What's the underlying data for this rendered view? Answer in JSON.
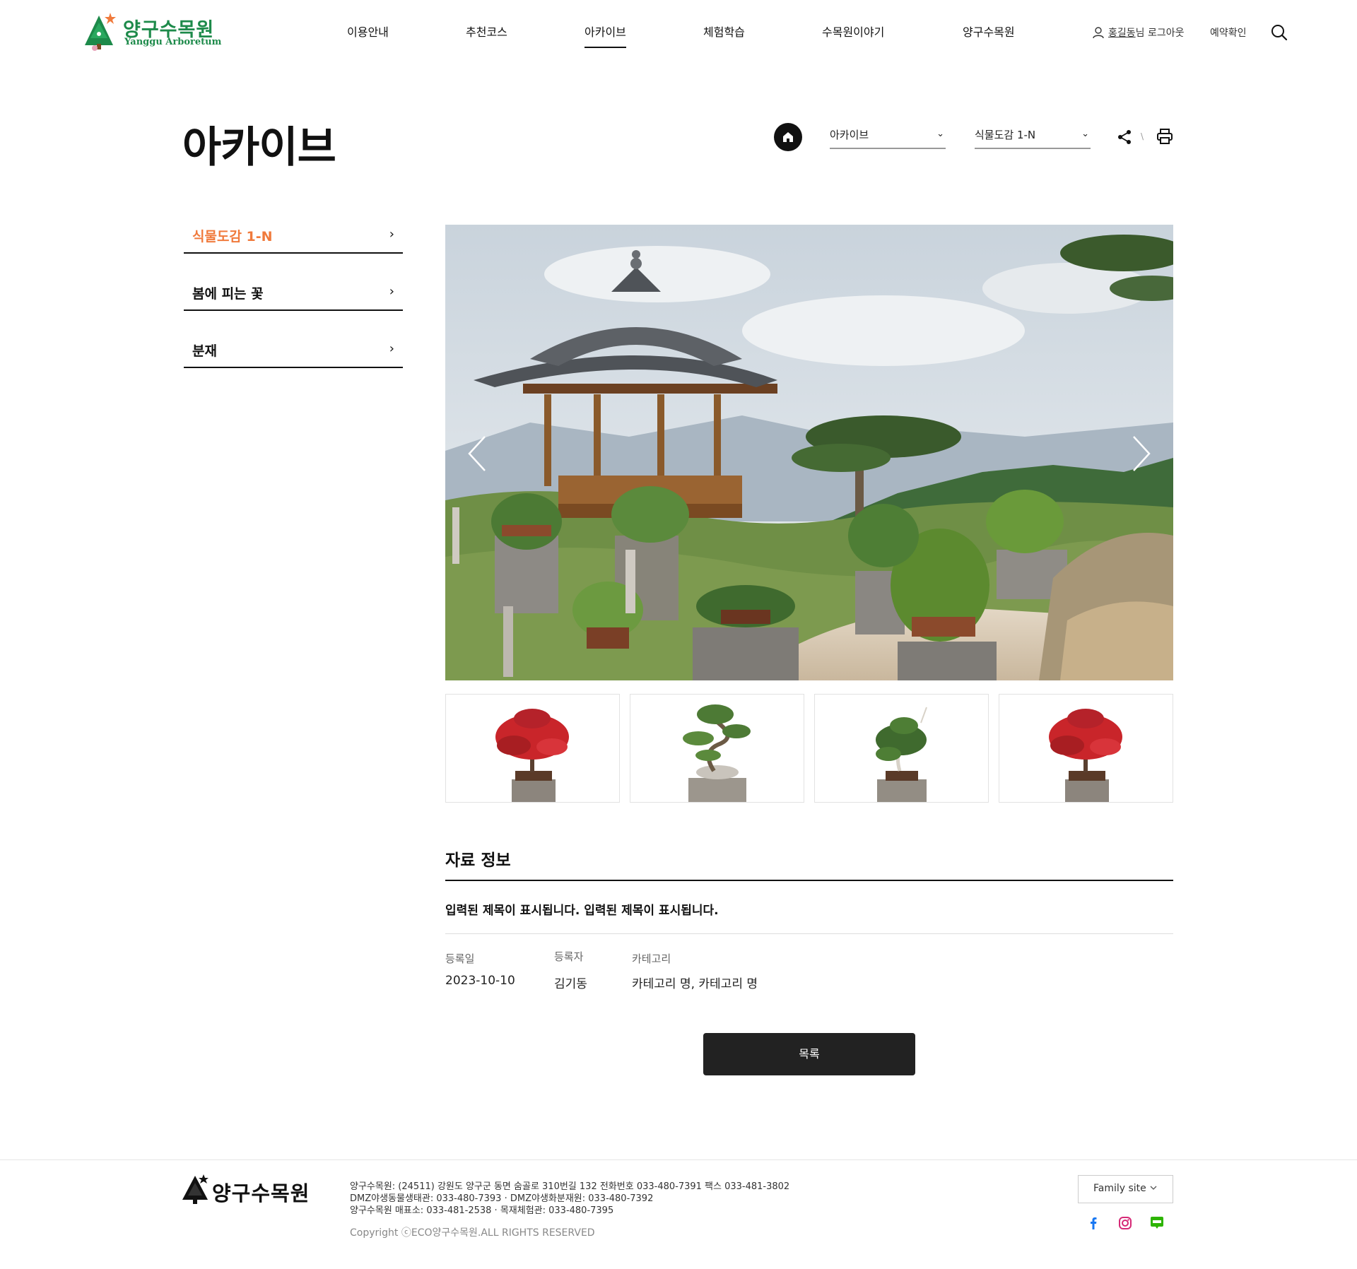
{
  "header": {
    "logo_ko": "양구수목원",
    "logo_en": "Yanggu Arboretum",
    "nav": [
      {
        "label": "이용안내",
        "active": false
      },
      {
        "label": "추천코스",
        "active": false
      },
      {
        "label": "아카이브",
        "active": true
      },
      {
        "label": "체험학습",
        "active": false
      },
      {
        "label": "수목원이야기",
        "active": false
      },
      {
        "label": "양구수목원",
        "active": false
      }
    ],
    "user_name": "홍길동",
    "user_suffix": "님 로그아웃",
    "reservation_check": "예약확인",
    "search_icon": "search-icon"
  },
  "page": {
    "title": "아카이브",
    "location": {
      "depth1": "아카이브",
      "depth2": "식물도감 1-N"
    }
  },
  "side_menu": [
    {
      "label": "식물도감 1-N",
      "active": true
    },
    {
      "label": "봄에 피는 꽃",
      "active": false
    },
    {
      "label": "분재",
      "active": false
    }
  ],
  "gallery": {
    "main_image": "pavilion-bonsai-garden-photo",
    "thumbnails": [
      "red-maple-bonsai",
      "pine-bonsai",
      "juniper-bonsai",
      "red-maple-bonsai"
    ]
  },
  "info": {
    "heading": "자료 정보",
    "title": "입력된 제목이 표시됩니다. 입력된 제목이 표시됩니다.",
    "meta": [
      {
        "label": "등록일",
        "value": "2023-10-10"
      },
      {
        "label": "등록자",
        "value": "김기동"
      },
      {
        "label": "카테고리",
        "value": "카테고리 명, 카테고리 명"
      }
    ],
    "list_button": "목록"
  },
  "footer": {
    "logo": "양구수목원",
    "address_lines": [
      "양구수목원: (24511) 강원도 양구군 동면 숨골로 310번길 132 전화번호 033-480-7391 팩스 033-481-3802",
      "DMZ야생동물생태관: 033-480-7393 · DMZ야생화분재원: 033-480-7392",
      "양구수목원 매표소: 033-481-2538 · 목재체험관: 033-480-7395"
    ],
    "copyright": "Copyright ⓒECO양구수목원.ALL RIGHTS RESERVED",
    "family_site": "Family site",
    "sns": [
      "facebook-icon",
      "instagram-icon",
      "blog-icon"
    ]
  },
  "colors": {
    "brand_green": "#1d8a4a",
    "accent_orange": "#f07a3c",
    "dark": "#222222"
  }
}
